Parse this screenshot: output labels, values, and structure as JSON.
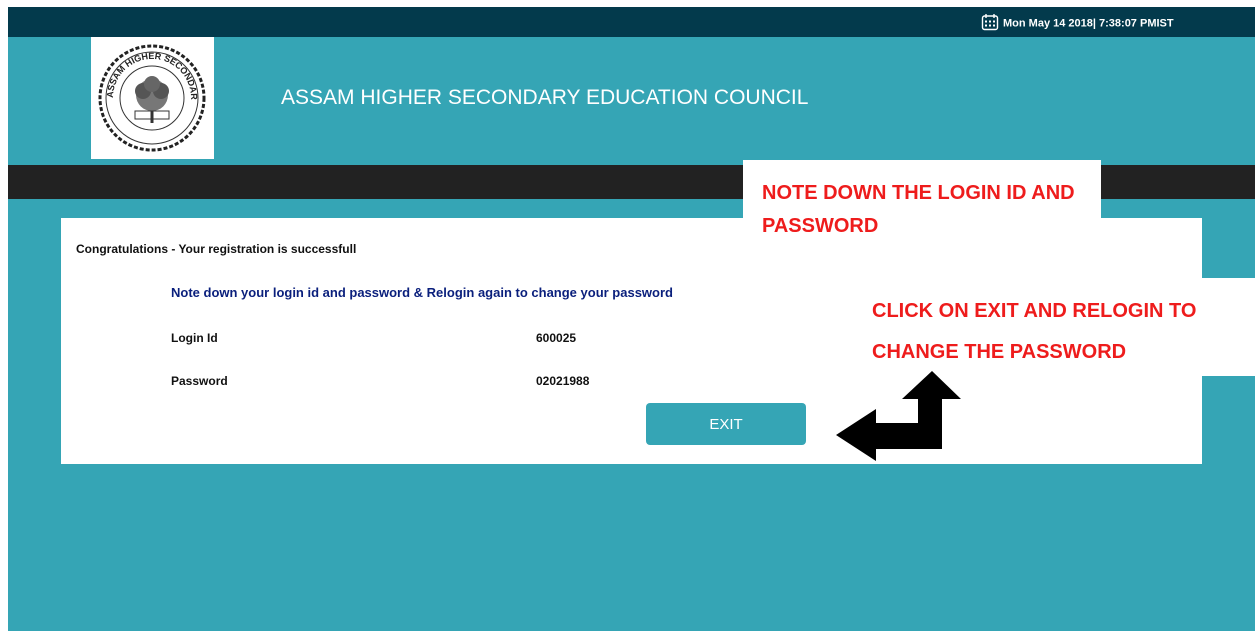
{
  "header": {
    "datetime": "Mon May 14 2018| 7:38:07 PMIST",
    "title": "ASSAM HIGHER SECONDARY EDUCATION COUNCIL",
    "logo_text": "ASSAM HIGHER SECONDARY EDUCATION COUNCIL"
  },
  "panel": {
    "congrats": "Congratulations - Your registration is successfull",
    "note": "Note down your login id and password & Relogin again to change your password",
    "login_label": "Login Id",
    "login_value": "600025",
    "password_label": "Password",
    "password_value": "02021988",
    "exit_label": "EXIT"
  },
  "annotations": {
    "callout1": "NOTE DOWN THE LOGIN ID AND PASSWORD",
    "callout2_line1": "CLICK ON EXIT AND RELOGIN TO",
    "callout2_line2": "CHANGE THE PASSWORD"
  },
  "colors": {
    "page_bg": "#35a5b5",
    "topbar": "#033a4c",
    "darkbar": "#222222",
    "annotation_red": "#ee1c1c",
    "note_blue": "#0a1f7c"
  },
  "icons": [
    "calendar-icon",
    "arrow-icon"
  ]
}
